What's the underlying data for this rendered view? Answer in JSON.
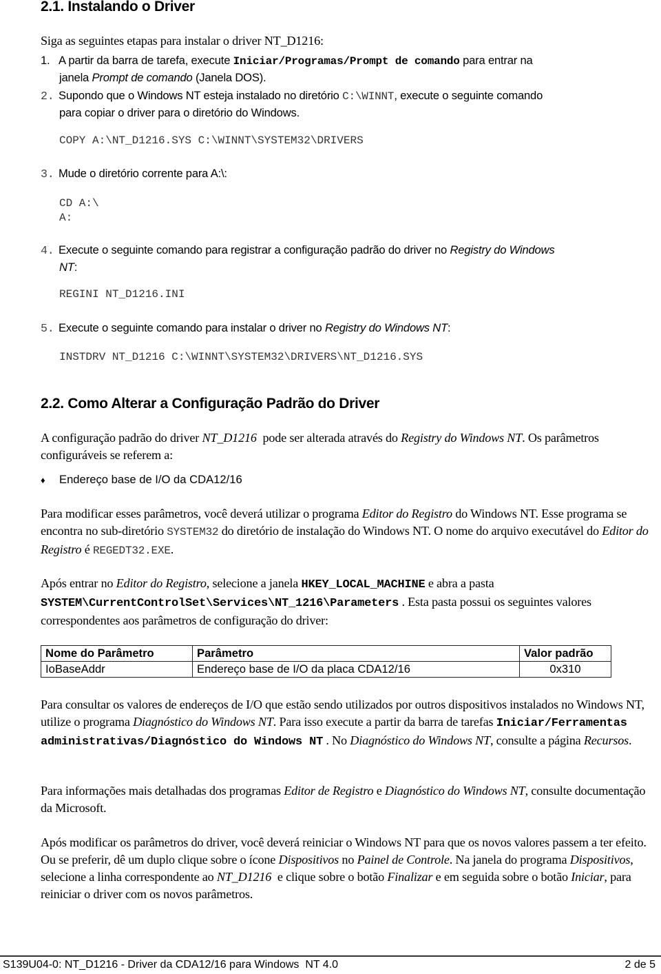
{
  "section1": {
    "title": "2.1. Instalando o Driver",
    "intro": "Siga as seguintes etapas para instalar o driver NT_D1216:",
    "steps": [
      {
        "num": "1.",
        "text_a": "A partir da barra de tarefa, execute ",
        "cmd": "Iniciar/Programas/Prompt de comando",
        "text_b": " para entrar na",
        "text_c": "janela ",
        "italic": "Prompt de comando",
        "text_d": " (Janela DOS)."
      },
      {
        "num": "2.",
        "text_a": "Supondo que o Windows NT esteja instalado no diretório ",
        "path": "C:\\WINNT",
        "text_b": ", execute o seguinte comando",
        "text_c": "para copiar o driver para o diretório do Windows.",
        "code": "COPY A:\\NT_D1216.SYS C:\\WINNT\\SYSTEM32\\DRIVERS"
      },
      {
        "num": "3.",
        "text_a": "Mude o diretório corrente para A:\\:",
        "code_lines": [
          "CD A:\\",
          "A:"
        ]
      },
      {
        "num": "4.",
        "text_a": "Execute o seguinte comando para registrar a configuração padrão do driver no ",
        "italic": "Registry do Windows",
        "italic2": "NT",
        "text_b": ":",
        "code": "REGINI NT_D1216.INI"
      },
      {
        "num": "5.",
        "text_a": "Execute o seguinte comando para instalar o driver no ",
        "italic": "Registry do Windows NT",
        "text_b": ":",
        "code": "INSTDRV NT_D1216 C:\\WINNT\\SYSTEM32\\DRIVERS\\NT_D1216.SYS"
      }
    ]
  },
  "section2": {
    "title": "2.2. Como Alterar a Configuração Padrão do Driver",
    "p1": {
      "a": "A configuração padrão do driver ",
      "i1": "NT_D1216",
      "b": "  pode ser alterada através do ",
      "i2": "Registry do Windows NT",
      "c": ". Os parâmetros configuráveis se referem a:"
    },
    "bullet_icon": "diamond-bullet-icon",
    "bullet_text": "Endereço base de I/O da CDA12/16",
    "p2": {
      "a": "Para modificar esses parâmetros, você deverá utilizar o programa ",
      "i1": "Editor do Registro",
      "b": " do Windows NT. Esse programa se encontra no sub-diretório ",
      "m1": "SYSTEM32",
      "c": " do diretório de instalação do Windows NT. O nome do arquivo executável do ",
      "i2": "Editor do Registro",
      "d": " é ",
      "m2": "REGEDT32.EXE",
      "e": "."
    },
    "p3": {
      "a": "Após entrar no ",
      "i1": "Editor do Registro",
      "b": ", selecione a janela ",
      "m1": "HKEY_LOCAL_MACHINE",
      "c": " e abra a pasta ",
      "m2": "SYSTEM\\CurrentControlSet\\Services\\NT_1216\\Parameters",
      "d": " . Esta pasta possui os seguintes valores correspondentes aos parâmetros de configuração do driver:"
    },
    "table": {
      "headers": [
        "Nome do Parâmetro",
        "Parâmetro",
        "Valor padrão"
      ],
      "rows": [
        [
          "IoBaseAddr",
          "Endereço base de I/O da placa CDA12/16",
          "0x310"
        ]
      ]
    },
    "p4": {
      "a": "Para consultar os valores de endereços de I/O que estão sendo utilizados por outros dispositivos instalados no Windows NT, utilize o programa ",
      "i1": "Diagnóstico do Windows NT",
      "b": ". Para isso execute a partir da barra de tarefas ",
      "m1": "Iniciar/Ferramentas administrativas/Diagnóstico do Windows NT",
      "c": " . No ",
      "i2": "Diagnóstico do Windows NT",
      "d": ", consulte a página ",
      "i3": "Recursos",
      "e": "."
    },
    "p5": {
      "a": "Para informações mais detalhadas dos programas ",
      "i1": "Editor de Registro",
      "b": " e ",
      "i2": "Diagnóstico do Windows NT",
      "c": ", consulte documentação da Microsoft."
    },
    "p6": {
      "a": "Após modificar os parâmetros do driver, você deverá reiniciar o Windows NT para que os novos valores passem a ter efeito. Ou se preferir, dê um duplo clique sobre o ícone ",
      "i1": "Dispositivos",
      "b": " no ",
      "i2": "Painel de Controle",
      "c": ". Na janela do programa ",
      "i3": "Dispositivos",
      "d": ", selecione a linha correspondente ao ",
      "i4": "NT_D1216",
      "e": "  e clique sobre o botão ",
      "i5": "Finalizar",
      "f": " e em seguida sobre o botão ",
      "i6": "Iniciar",
      "g": ", para reiniciar o driver com os novos parâmetros."
    }
  },
  "footer": {
    "left": "S139U04-0: NT_D1216 - Driver da CDA12/16 para Windows  NT 4.0",
    "right": "2 de 5"
  }
}
